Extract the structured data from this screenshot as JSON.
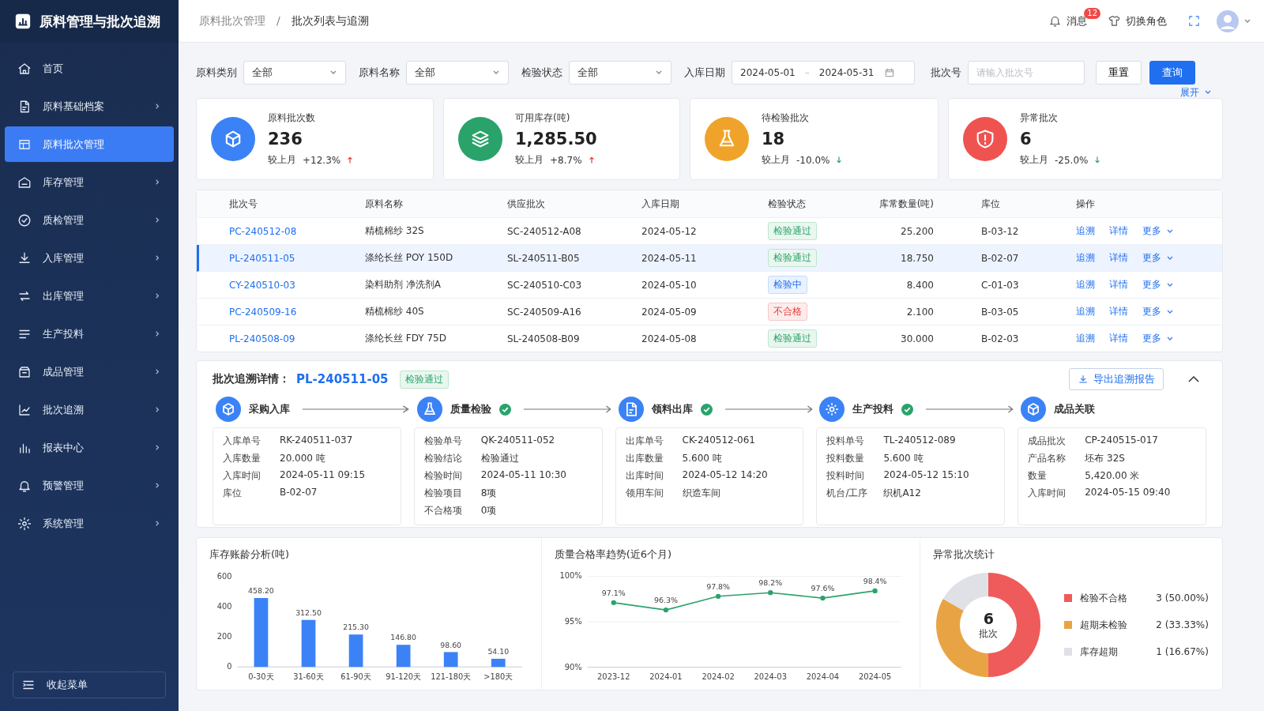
{
  "app": {
    "title": "原料管理与批次追溯"
  },
  "sidebar": {
    "items": [
      {
        "label": "首页",
        "selected": false,
        "expandable": false
      },
      {
        "label": "原料基础档案",
        "selected": false,
        "expandable": true
      },
      {
        "label": "原料批次管理",
        "selected": true,
        "expandable": false
      },
      {
        "label": "库存管理",
        "selected": false,
        "expandable": true
      },
      {
        "label": "质检管理",
        "selected": false,
        "expandable": true
      },
      {
        "label": "入库管理",
        "selected": false,
        "expandable": true
      },
      {
        "label": "出库管理",
        "selected": false,
        "expandable": true
      },
      {
        "label": "生产投料",
        "selected": false,
        "expandable": true
      },
      {
        "label": "成品管理",
        "selected": false,
        "expandable": true
      },
      {
        "label": "批次追溯",
        "selected": false,
        "expandable": true
      },
      {
        "label": "报表中心",
        "selected": false,
        "expandable": true
      },
      {
        "label": "预警管理",
        "selected": false,
        "expandable": true
      },
      {
        "label": "系统管理",
        "selected": false,
        "expandable": true
      }
    ],
    "collapse_label": "收起菜单"
  },
  "header": {
    "breadcrumb": [
      "原料批次管理",
      "/",
      "批次列表与追溯"
    ],
    "messages_label": "消息",
    "message_count": "12",
    "role_label": "切换角色"
  },
  "filters": {
    "fields": [
      {
        "kind": "select",
        "label": "原料类别",
        "value": "全部"
      },
      {
        "kind": "select",
        "label": "原料名称",
        "value": "全部"
      },
      {
        "kind": "select",
        "label": "检验状态",
        "value": "全部"
      },
      {
        "kind": "daterange",
        "label": "入库日期",
        "start": "2024-05-01",
        "separator": "–",
        "end": "2024-05-31"
      },
      {
        "kind": "input",
        "label": "批次号",
        "placeholder": "请输入批次号"
      }
    ],
    "reset_label": "重置",
    "query_label": "查询",
    "expand_label": "展开"
  },
  "kpis": [
    {
      "title": "原料批次数",
      "value": "236",
      "compare_label": "较上月",
      "change": "+12.3%",
      "rising": true,
      "color": "#3b82f6"
    },
    {
      "title": "可用库存(吨)",
      "value": "1,285.50",
      "compare_label": "较上月",
      "change": "+8.7%",
      "rising": true,
      "color": "#2aa36b"
    },
    {
      "title": "待检验批次",
      "value": "18",
      "compare_label": "较上月",
      "change": "-10.0%",
      "rising": false,
      "color": "#f0a32a"
    },
    {
      "title": "异常批次",
      "value": "6",
      "compare_label": "较上月",
      "change": "-25.0%",
      "rising": false,
      "color": "#ef5350"
    }
  ],
  "table": {
    "columns": [
      "批次号",
      "原料名称",
      "供应批次",
      "入库日期",
      "检验状态",
      "库常数量(吨)",
      "库位",
      "操作"
    ],
    "rows": [
      {
        "batch": "PC-240512-08",
        "material": "精梳棉纱 32S",
        "supply": "SC-240512-A08",
        "date": "2024-05-12",
        "status": {
          "kind": "pass",
          "text": "检验通过"
        },
        "qty": "25.200",
        "location": "B-03-12",
        "actions": [
          "追溯",
          "详情",
          "更多"
        ],
        "selected": false
      },
      {
        "batch": "PL-240511-05",
        "material": "涤纶长丝 POY 150D",
        "supply": "SL-240511-B05",
        "date": "2024-05-11",
        "status": {
          "kind": "pass",
          "text": "检验通过"
        },
        "qty": "18.750",
        "location": "B-02-07",
        "actions": [
          "追溯",
          "详情",
          "更多"
        ],
        "selected": true
      },
      {
        "batch": "CY-240510-03",
        "material": "染料助剂 净洗剂A",
        "supply": "SC-240510-C03",
        "date": "2024-05-10",
        "status": {
          "kind": "checking",
          "text": "检验中"
        },
        "qty": "8.400",
        "location": "C-01-03",
        "actions": [
          "追溯",
          "详情",
          "更多"
        ],
        "selected": false
      },
      {
        "batch": "PC-240509-16",
        "material": "精梳棉纱 40S",
        "supply": "SC-240509-A16",
        "date": "2024-05-09",
        "status": {
          "kind": "fail",
          "text": "不合格"
        },
        "qty": "2.100",
        "location": "B-03-05",
        "actions": [
          "追溯",
          "详情",
          "更多"
        ],
        "selected": false
      },
      {
        "batch": "PL-240508-09",
        "material": "涤纶长丝 FDY 75D",
        "supply": "SL-240508-B09",
        "date": "2024-05-08",
        "status": {
          "kind": "pass",
          "text": "检验通过"
        },
        "qty": "30.000",
        "location": "B-02-03",
        "actions": [
          "追溯",
          "详情",
          "更多"
        ],
        "selected": false
      }
    ]
  },
  "trace": {
    "title": "批次追溯详情：",
    "batch": "PL-240511-05",
    "status": {
      "kind": "pass",
      "text": "检验通过"
    },
    "export_label": "导出追溯报告",
    "expanded": true,
    "steps": [
      {
        "title": "采购入库",
        "checked": false,
        "fields": [
          {
            "label": "入库单号",
            "value": "RK-240511-037"
          },
          {
            "label": "入库数量",
            "value": "20.000 吨"
          },
          {
            "label": "入库时间",
            "value": "2024-05-11 09:15"
          },
          {
            "label": "库位",
            "value": "B-02-07"
          }
        ]
      },
      {
        "title": "质量检验",
        "checked": true,
        "fields": [
          {
            "label": "检验单号",
            "value": "QK-240511-052"
          },
          {
            "label": "检验结论",
            "value": "检验通过"
          },
          {
            "label": "检验时间",
            "value": "2024-05-11 10:30"
          },
          {
            "label": "检验项目",
            "value": "8项"
          },
          {
            "label": "不合格项",
            "value": "0项"
          }
        ]
      },
      {
        "title": "领料出库",
        "checked": true,
        "fields": [
          {
            "label": "出库单号",
            "value": "CK-240512-061"
          },
          {
            "label": "出库数量",
            "value": "5.600 吨"
          },
          {
            "label": "出库时间",
            "value": "2024-05-12 14:20"
          },
          {
            "label": "领用车间",
            "value": "织造车间"
          }
        ]
      },
      {
        "title": "生产投料",
        "checked": true,
        "fields": [
          {
            "label": "投料单号",
            "value": "TL-240512-089"
          },
          {
            "label": "投料数量",
            "value": "5.600 吨"
          },
          {
            "label": "投料时间",
            "value": "2024-05-12 15:10"
          },
          {
            "label": "机台/工序",
            "value": "织机A12"
          }
        ]
      },
      {
        "title": "成品关联",
        "checked": false,
        "fields": [
          {
            "label": "成品批次",
            "value": "CP-240515-017"
          },
          {
            "label": "产品名称",
            "value": "坯布 32S"
          },
          {
            "label": "数量",
            "value": "5,420.00 米"
          },
          {
            "label": "入库时间",
            "value": "2024-05-15 09:40"
          }
        ]
      }
    ]
  },
  "charts": [
    {
      "title": "库存账龄分析(吨)",
      "chart_data": {
        "type": "bar",
        "categories": [
          "0-30天",
          "31-60天",
          "61-90天",
          "91-120天",
          "121-180天",
          ">180天"
        ],
        "series": [
          {
            "color": "#3b82f6",
            "values": [
              458.2,
              312.5,
              215.3,
              146.8,
              98.6,
              54.1
            ]
          }
        ],
        "ylim": [
          0,
          600
        ],
        "yticks": [
          0,
          200,
          400,
          600
        ],
        "value_labels": [
          "458.20",
          "312.50",
          "215.30",
          "146.80",
          "98.60",
          "54.10"
        ]
      }
    },
    {
      "title": "质量合格率趋势(近6个月)",
      "chart_data": {
        "type": "line",
        "x": [
          "2023-12",
          "2024-01",
          "2024-02",
          "2024-03",
          "2024-04",
          "2024-05"
        ],
        "series": [
          {
            "color": "#2aa36b",
            "marker": true,
            "values": [
              97.1,
              96.3,
              97.8,
              98.2,
              97.6,
              98.4
            ]
          }
        ],
        "ylim": [
          90,
          100
        ],
        "yticks": [
          {
            "value": 90,
            "label": "90%"
          },
          {
            "value": 95,
            "label": "95%"
          },
          {
            "value": 100,
            "label": "100%"
          }
        ],
        "value_labels": [
          "97.1%",
          "96.3%",
          "97.8%",
          "98.2%",
          "97.6%",
          "98.4%"
        ]
      }
    },
    {
      "title": "异常批次统计",
      "center_value": "6",
      "center_label": "批次",
      "chart_data": {
        "type": "donut",
        "categories": [
          "检验不合格",
          "超期未检验",
          "库存超期"
        ],
        "series": [
          {
            "values": [
              50.0,
              33.33,
              16.67
            ]
          }
        ],
        "colors": [
          "#ef5b5b",
          "#e8a444",
          "#dfe1e6"
        ],
        "value_labels": [
          "3 (50.00%)",
          "2 (33.33%)",
          "1 (16.67%)"
        ]
      }
    }
  ]
}
